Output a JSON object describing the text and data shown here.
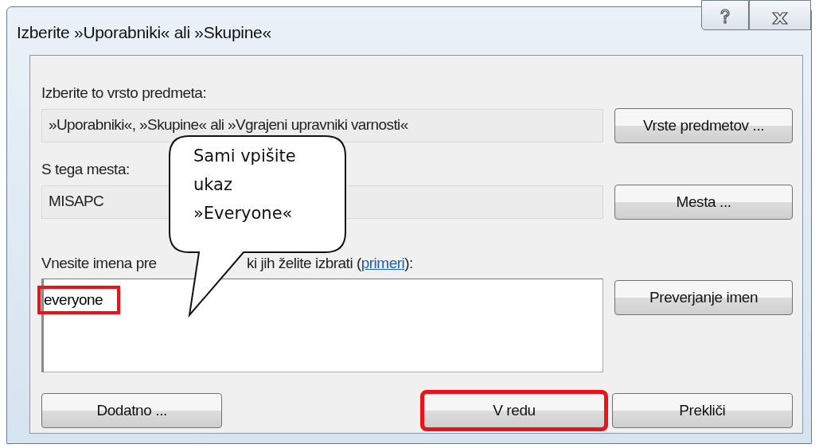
{
  "window": {
    "title": "Izberite »Uporabniki« ali »Skupine«"
  },
  "object_type": {
    "label": "Izberite to vrsto predmeta:",
    "value": "»Uporabniki«, »Skupine« ali »Vgrajeni upravniki varnosti«",
    "button": "Vrste predmetov ..."
  },
  "location": {
    "label": "S tega mesta:",
    "value": "MISAPC",
    "button": "Mesta ..."
  },
  "names": {
    "label_start": "Vnesite imena pre",
    "label_end": "ki jih želite izbrati (",
    "link": "primeri",
    "label_close": "):",
    "value": "everyone",
    "highlighted": true,
    "button": "Preverjanje imen"
  },
  "buttons": [
    {
      "label": "Dodatno ...",
      "highlighted": false
    },
    {
      "label": "V redu",
      "highlighted": true
    },
    {
      "label": "Prekliči",
      "highlighted": false
    }
  ],
  "callout": {
    "lines": [
      "Sami vpišite",
      "ukaz",
      "»Everyone«"
    ]
  }
}
